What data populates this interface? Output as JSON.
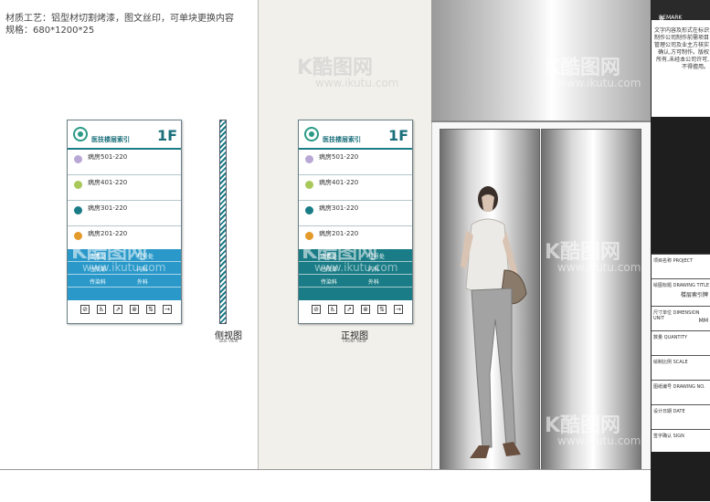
{
  "spec": {
    "line1": "材质工艺：铝型材切割烤漆，图文丝印，可单块更换内容",
    "line2": "规格：680*1200*25"
  },
  "sign": {
    "floor_name": "医技楼层索引",
    "floor": "1F",
    "rows": [
      {
        "label": "病房501-220",
        "color": "#b9a8d6"
      },
      {
        "label": "病房401-220",
        "color": "#a8c95a"
      },
      {
        "label": "病房301-220",
        "color": "#1a7c86"
      },
      {
        "label": "病房201-220",
        "color": "#e39a2b"
      }
    ],
    "band_rows": [
      {
        "left": "收费处",
        "right": "挂号处"
      },
      {
        "left": "住院部",
        "right": "内科"
      },
      {
        "left": "传染科",
        "right": "外科"
      }
    ]
  },
  "views": {
    "side_title": "侧视图",
    "side_sub": "SIDE VIEW",
    "front_title": "正视图",
    "front_sub": "FRONT VIEW"
  },
  "watermark": {
    "brand": "K酷图网",
    "url": "www.ikutu.com"
  },
  "title_block": {
    "header_cn": "备注",
    "header_en": "REMARK",
    "remark": "文字内容及形式在标识制作公司制作前需项目管理公司及业主方核实确认,方可制作。版权所有,未经本公司许可,不得擅用。",
    "rows": [
      {
        "cn": "项目名称",
        "en": "PROJECT",
        "value": ""
      },
      {
        "cn": "绘图标题",
        "en": "DRAWING TITLE",
        "value": "楼层索引牌"
      },
      {
        "cn": "尺寸单位",
        "en": "DIMENSION UNIT",
        "value": "MM"
      },
      {
        "cn": "数量",
        "en": "QUANTITY",
        "value": ""
      },
      {
        "cn": "绘制比例",
        "en": "SCALE",
        "value": ""
      },
      {
        "cn": "图纸编号",
        "en": "DRAWING NO.",
        "value": ""
      },
      {
        "cn": "设计日期",
        "en": "DATE",
        "value": ""
      },
      {
        "cn": "签字确认",
        "en": "SIGN",
        "value": ""
      }
    ]
  }
}
